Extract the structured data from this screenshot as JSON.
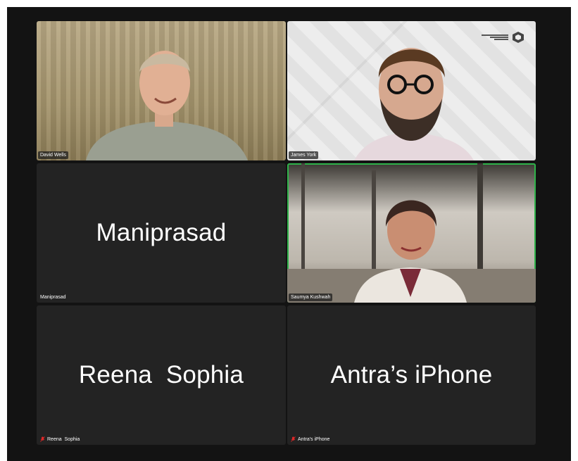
{
  "meeting": {
    "participants": [
      {
        "name": "David Wells",
        "video": true,
        "muted": false
      },
      {
        "name": "James York",
        "video": true,
        "muted": false
      },
      {
        "name": "Maniprasad",
        "display_name": "Maniprasad",
        "video": false,
        "muted": false
      },
      {
        "name": "Saumya Kushwah",
        "video": true,
        "muted": false,
        "active_speaker": true
      },
      {
        "name": "Reena  Sophia",
        "display_name": "Reena  Sophia",
        "video": false,
        "muted": true
      },
      {
        "name": "Antra’s iPhone",
        "display_name": "Antra’s iPhone",
        "video": false,
        "muted": true
      }
    ]
  },
  "colors": {
    "window_bg": "#131313",
    "tile_bg": "#232323",
    "active_speaker_border": "#2fb34a",
    "muted_icon": "#e02828"
  },
  "icons": {
    "muted": "microphone-muted-icon"
  }
}
